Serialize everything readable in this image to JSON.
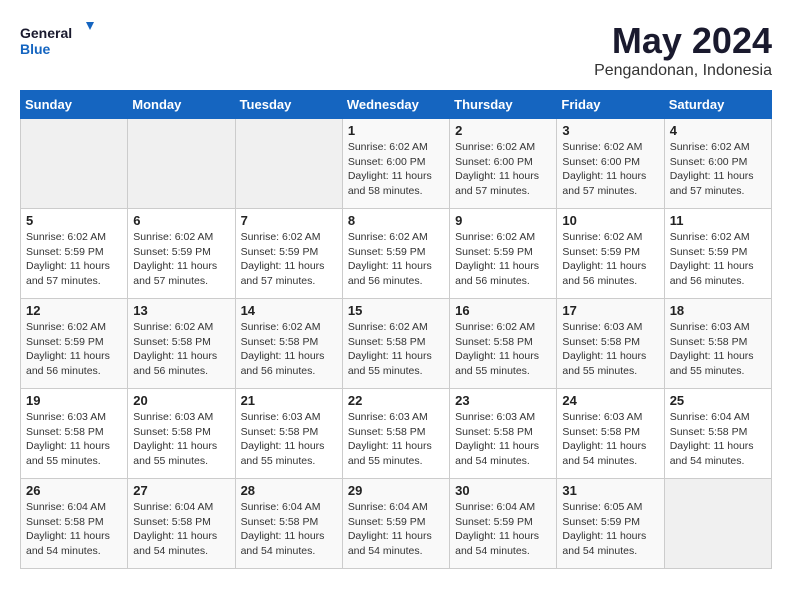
{
  "header": {
    "logo_line1": "General",
    "logo_line2": "Blue",
    "month": "May 2024",
    "location": "Pengandonan, Indonesia"
  },
  "weekdays": [
    "Sunday",
    "Monday",
    "Tuesday",
    "Wednesday",
    "Thursday",
    "Friday",
    "Saturday"
  ],
  "weeks": [
    [
      {
        "day": "",
        "empty": true
      },
      {
        "day": "",
        "empty": true
      },
      {
        "day": "",
        "empty": true
      },
      {
        "day": "1",
        "sunrise": "6:02 AM",
        "sunset": "6:00 PM",
        "daylight": "11 hours and 58 minutes."
      },
      {
        "day": "2",
        "sunrise": "6:02 AM",
        "sunset": "6:00 PM",
        "daylight": "11 hours and 57 minutes."
      },
      {
        "day": "3",
        "sunrise": "6:02 AM",
        "sunset": "6:00 PM",
        "daylight": "11 hours and 57 minutes."
      },
      {
        "day": "4",
        "sunrise": "6:02 AM",
        "sunset": "6:00 PM",
        "daylight": "11 hours and 57 minutes."
      }
    ],
    [
      {
        "day": "5",
        "sunrise": "6:02 AM",
        "sunset": "5:59 PM",
        "daylight": "11 hours and 57 minutes."
      },
      {
        "day": "6",
        "sunrise": "6:02 AM",
        "sunset": "5:59 PM",
        "daylight": "11 hours and 57 minutes."
      },
      {
        "day": "7",
        "sunrise": "6:02 AM",
        "sunset": "5:59 PM",
        "daylight": "11 hours and 57 minutes."
      },
      {
        "day": "8",
        "sunrise": "6:02 AM",
        "sunset": "5:59 PM",
        "daylight": "11 hours and 56 minutes."
      },
      {
        "day": "9",
        "sunrise": "6:02 AM",
        "sunset": "5:59 PM",
        "daylight": "11 hours and 56 minutes."
      },
      {
        "day": "10",
        "sunrise": "6:02 AM",
        "sunset": "5:59 PM",
        "daylight": "11 hours and 56 minutes."
      },
      {
        "day": "11",
        "sunrise": "6:02 AM",
        "sunset": "5:59 PM",
        "daylight": "11 hours and 56 minutes."
      }
    ],
    [
      {
        "day": "12",
        "sunrise": "6:02 AM",
        "sunset": "5:59 PM",
        "daylight": "11 hours and 56 minutes."
      },
      {
        "day": "13",
        "sunrise": "6:02 AM",
        "sunset": "5:58 PM",
        "daylight": "11 hours and 56 minutes."
      },
      {
        "day": "14",
        "sunrise": "6:02 AM",
        "sunset": "5:58 PM",
        "daylight": "11 hours and 56 minutes."
      },
      {
        "day": "15",
        "sunrise": "6:02 AM",
        "sunset": "5:58 PM",
        "daylight": "11 hours and 55 minutes."
      },
      {
        "day": "16",
        "sunrise": "6:02 AM",
        "sunset": "5:58 PM",
        "daylight": "11 hours and 55 minutes."
      },
      {
        "day": "17",
        "sunrise": "6:03 AM",
        "sunset": "5:58 PM",
        "daylight": "11 hours and 55 minutes."
      },
      {
        "day": "18",
        "sunrise": "6:03 AM",
        "sunset": "5:58 PM",
        "daylight": "11 hours and 55 minutes."
      }
    ],
    [
      {
        "day": "19",
        "sunrise": "6:03 AM",
        "sunset": "5:58 PM",
        "daylight": "11 hours and 55 minutes."
      },
      {
        "day": "20",
        "sunrise": "6:03 AM",
        "sunset": "5:58 PM",
        "daylight": "11 hours and 55 minutes."
      },
      {
        "day": "21",
        "sunrise": "6:03 AM",
        "sunset": "5:58 PM",
        "daylight": "11 hours and 55 minutes."
      },
      {
        "day": "22",
        "sunrise": "6:03 AM",
        "sunset": "5:58 PM",
        "daylight": "11 hours and 55 minutes."
      },
      {
        "day": "23",
        "sunrise": "6:03 AM",
        "sunset": "5:58 PM",
        "daylight": "11 hours and 54 minutes."
      },
      {
        "day": "24",
        "sunrise": "6:03 AM",
        "sunset": "5:58 PM",
        "daylight": "11 hours and 54 minutes."
      },
      {
        "day": "25",
        "sunrise": "6:04 AM",
        "sunset": "5:58 PM",
        "daylight": "11 hours and 54 minutes."
      }
    ],
    [
      {
        "day": "26",
        "sunrise": "6:04 AM",
        "sunset": "5:58 PM",
        "daylight": "11 hours and 54 minutes."
      },
      {
        "day": "27",
        "sunrise": "6:04 AM",
        "sunset": "5:58 PM",
        "daylight": "11 hours and 54 minutes."
      },
      {
        "day": "28",
        "sunrise": "6:04 AM",
        "sunset": "5:58 PM",
        "daylight": "11 hours and 54 minutes."
      },
      {
        "day": "29",
        "sunrise": "6:04 AM",
        "sunset": "5:59 PM",
        "daylight": "11 hours and 54 minutes."
      },
      {
        "day": "30",
        "sunrise": "6:04 AM",
        "sunset": "5:59 PM",
        "daylight": "11 hours and 54 minutes."
      },
      {
        "day": "31",
        "sunrise": "6:05 AM",
        "sunset": "5:59 PM",
        "daylight": "11 hours and 54 minutes."
      },
      {
        "day": "",
        "empty": true
      }
    ]
  ]
}
